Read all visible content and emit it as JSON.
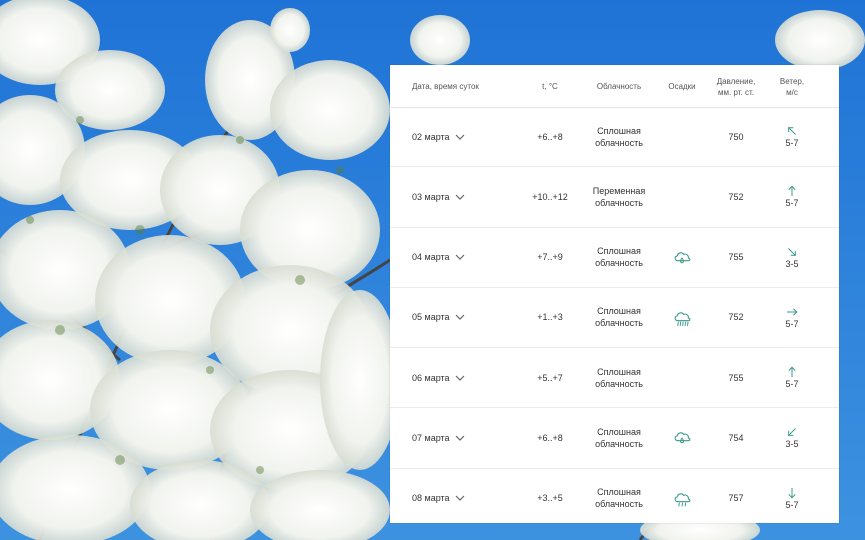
{
  "colors": {
    "accent": "#3b9a8a",
    "sky": "#2f83d8",
    "panel": "#ffffff"
  },
  "header": {
    "date": "Дата, время суток",
    "temp": "t, °C",
    "cloud": "Облачность",
    "precip": "Осадки",
    "pressure_1": "Давление,",
    "pressure_2": "мм. рт. ст.",
    "wind_1": "Ветер,",
    "wind_2": "м/с"
  },
  "rows": [
    {
      "date": "02 марта",
      "temp": "+6..+8",
      "cloud_1": "Сплошная",
      "cloud_2": "облачность",
      "precip_icon": "none",
      "pressure": "750",
      "wind_dir": "nw",
      "wind": "5-7"
    },
    {
      "date": "03 марта",
      "temp": "+10..+12",
      "cloud_1": "Переменная",
      "cloud_2": "облачность",
      "precip_icon": "none",
      "pressure": "752",
      "wind_dir": "n",
      "wind": "5-7"
    },
    {
      "date": "04 марта",
      "temp": "+7..+9",
      "cloud_1": "Сплошная",
      "cloud_2": "облачность",
      "precip_icon": "rain-drop-cloud-icon",
      "pressure": "755",
      "wind_dir": "se",
      "wind": "3-5"
    },
    {
      "date": "05 марта",
      "temp": "+1..+3",
      "cloud_1": "Сплошная",
      "cloud_2": "облачность",
      "precip_icon": "heavy-rain-cloud-icon",
      "pressure": "752",
      "wind_dir": "e",
      "wind": "5-7"
    },
    {
      "date": "06 марта",
      "temp": "+5..+7",
      "cloud_1": "Сплошная",
      "cloud_2": "облачность",
      "precip_icon": "none",
      "pressure": "755",
      "wind_dir": "n",
      "wind": "5-7"
    },
    {
      "date": "07 марта",
      "temp": "+6..+8",
      "cloud_1": "Сплошная",
      "cloud_2": "облачность",
      "precip_icon": "rain-drop-cloud-icon",
      "pressure": "754",
      "wind_dir": "sw",
      "wind": "3-5"
    },
    {
      "date": "08 марта",
      "temp": "+3..+5",
      "cloud_1": "Сплошная",
      "cloud_2": "облачность",
      "precip_icon": "rain-cloud-icon",
      "pressure": "757",
      "wind_dir": "s",
      "wind": "5-7"
    }
  ]
}
